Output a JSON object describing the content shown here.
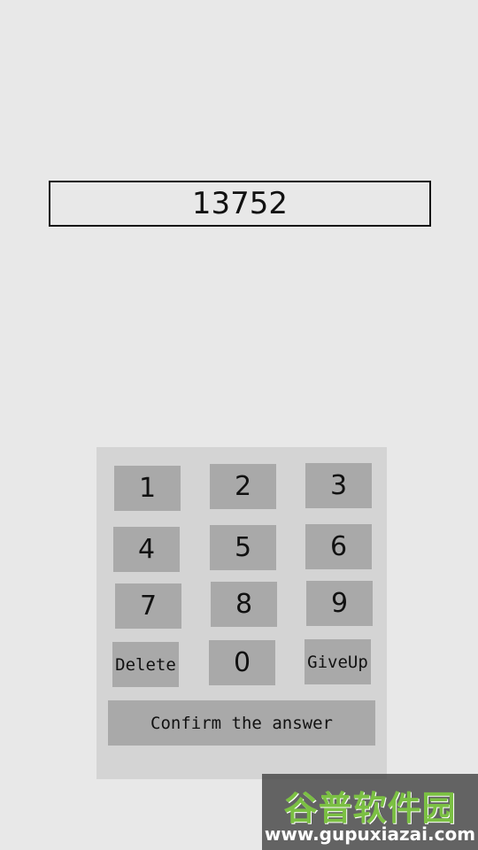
{
  "display": {
    "value": "13752"
  },
  "keypad": {
    "keys": [
      "1",
      "2",
      "3",
      "4",
      "5",
      "6",
      "7",
      "8",
      "9",
      "Delete",
      "0",
      "GiveUp"
    ],
    "confirm_label": "Confirm the answer"
  },
  "watermark": {
    "logo_text": "谷普软件园",
    "url": "www.gupuxiazai.com"
  },
  "colors": {
    "background": "#e8e8e8",
    "panel": "#d4d4d4",
    "key": "#a9a9a9",
    "text": "#111111",
    "watermark_green": "#7bc043"
  }
}
